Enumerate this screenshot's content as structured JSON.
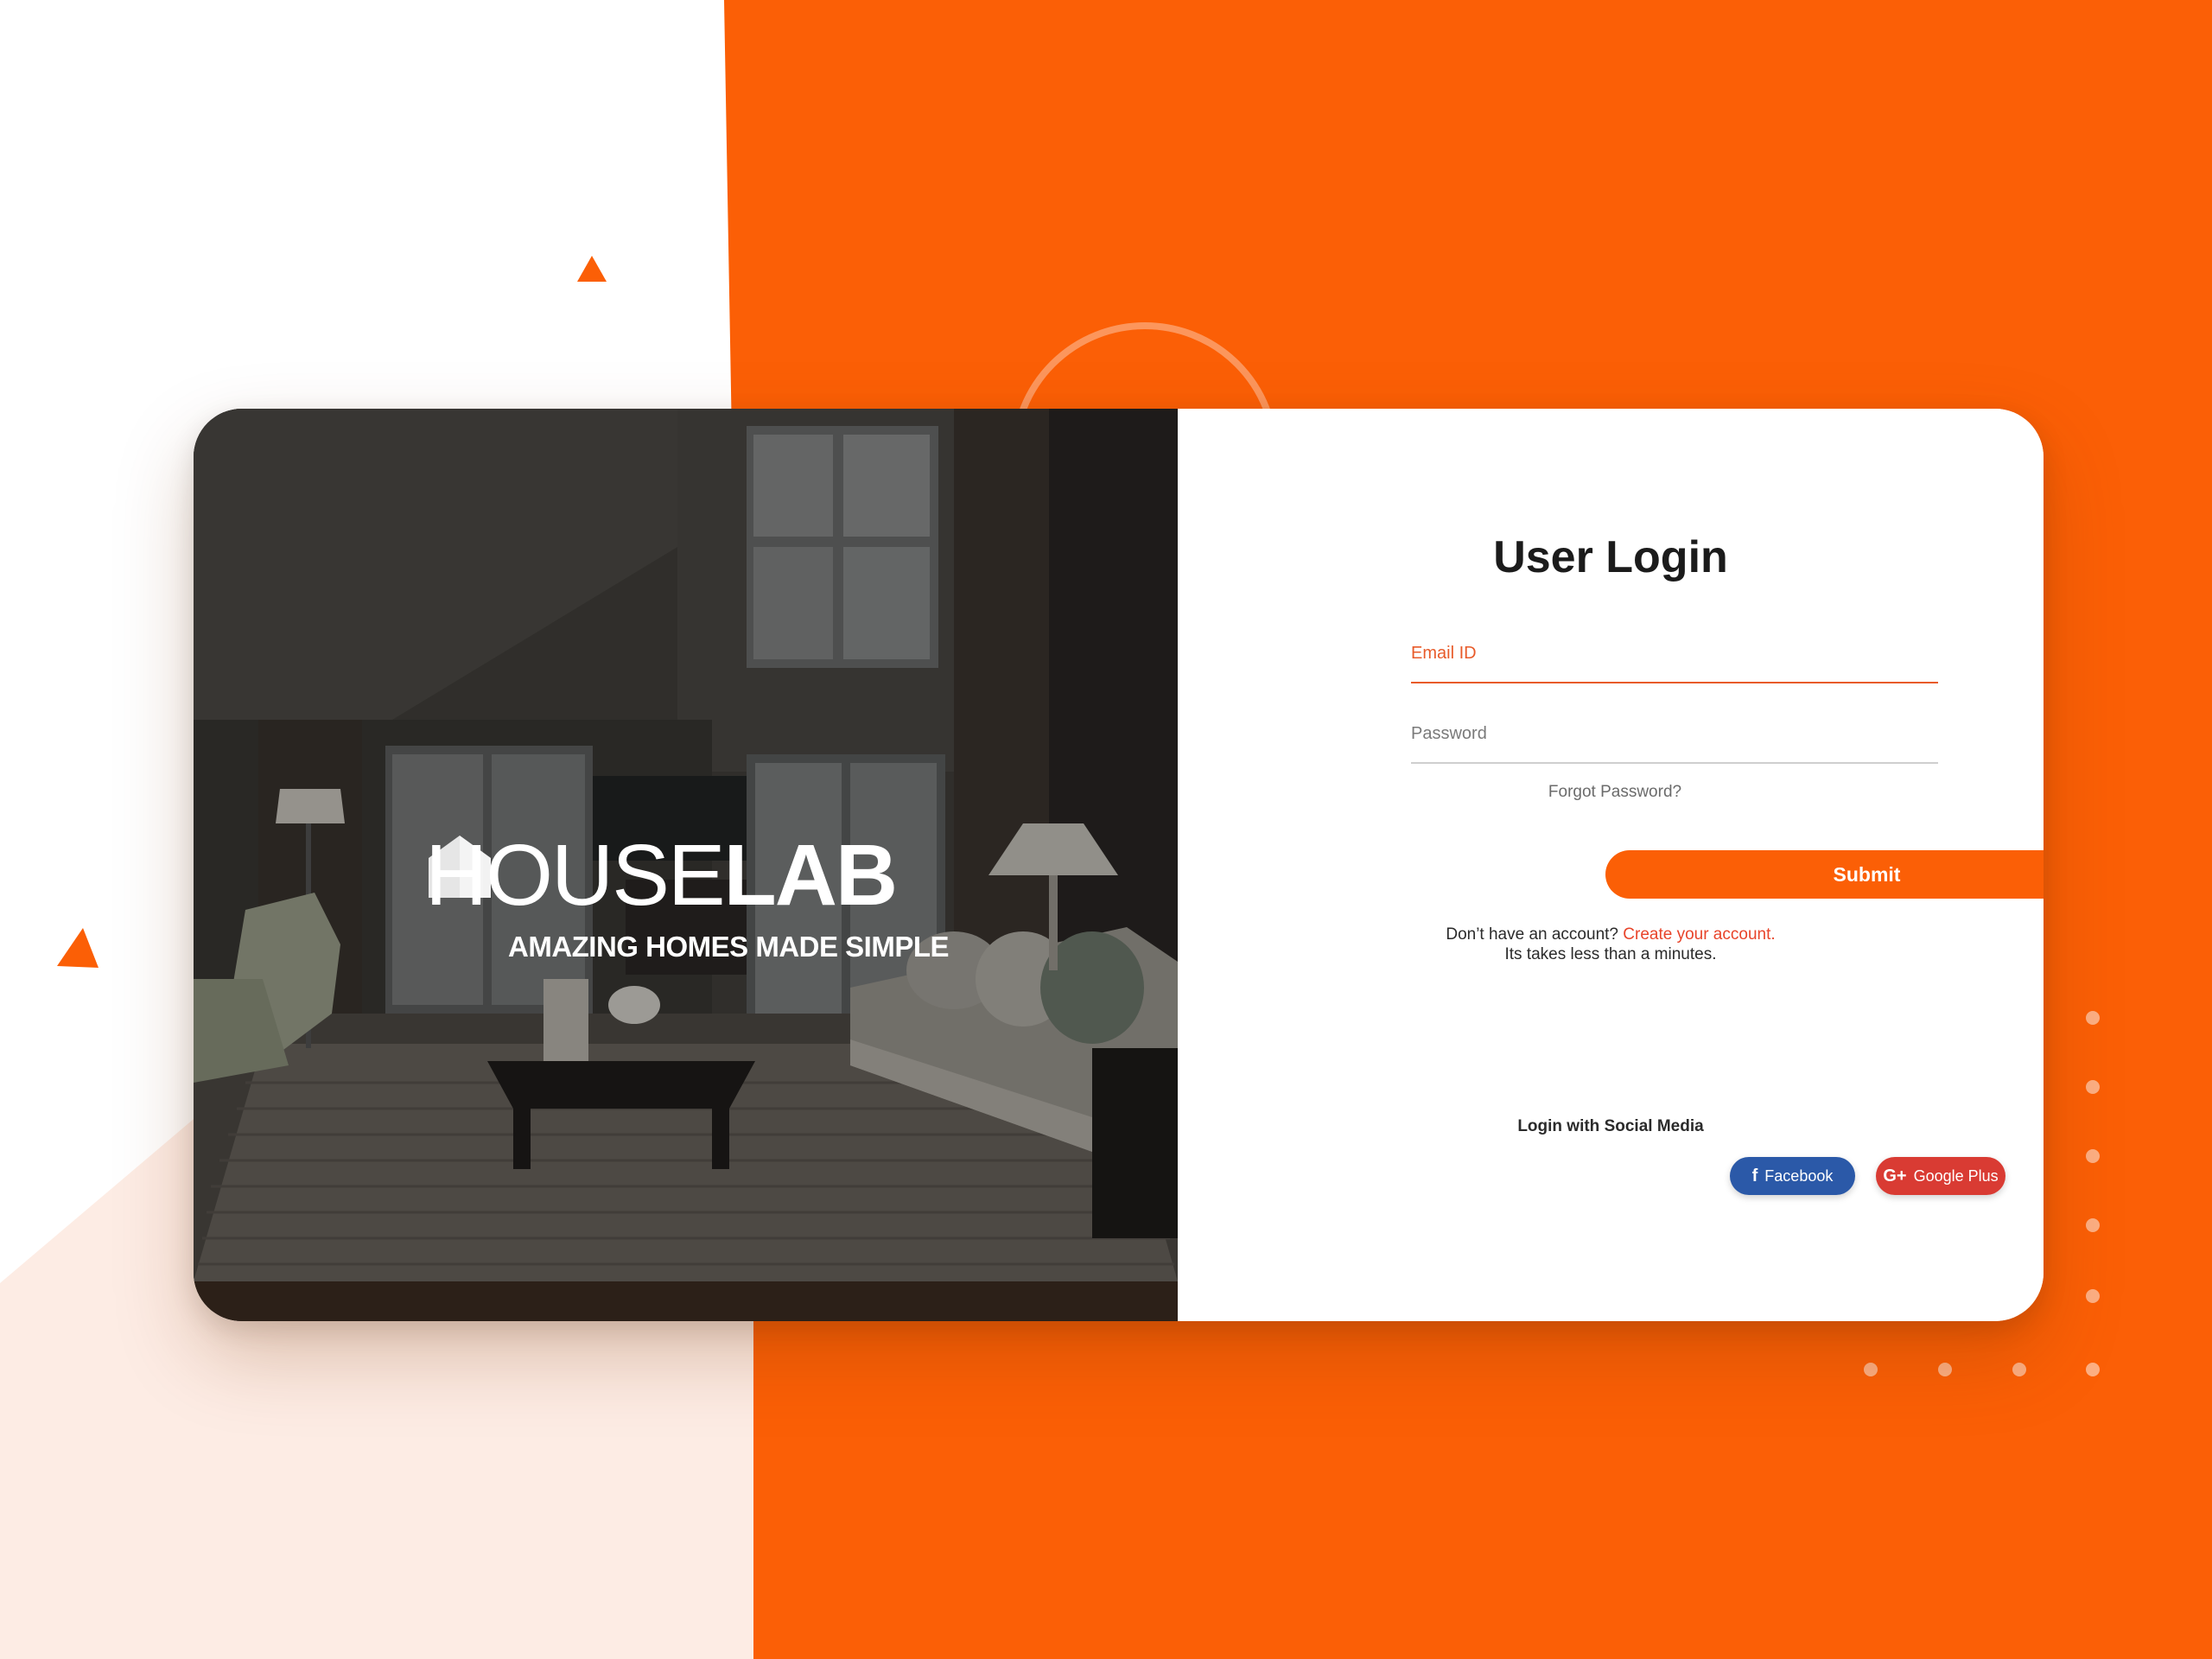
{
  "colors": {
    "accent": "#fb5f06",
    "link": "#e8442a",
    "facebook": "#2b59a8",
    "google_plus": "#d93b33"
  },
  "brand": {
    "name_part1": "HOUSE",
    "name_part2": "LAB",
    "tagline": "AMAZING HOMES MADE SIMPLE",
    "logo_icon": "house-icon"
  },
  "login": {
    "title": "User Login",
    "email_placeholder": "Email ID",
    "password_placeholder": "Password",
    "forgot_password": "Forgot Password?",
    "submit_label": "Submit",
    "signup_prompt": "Don’t have an account?",
    "signup_link": "Create your account.",
    "signup_note": "Its takes less than a minutes.",
    "social_title": "Login with Social Media",
    "facebook_label": "Facebook",
    "facebook_icon": "facebook-icon",
    "google_label": "Google Plus",
    "google_icon": "google-plus-icon"
  }
}
